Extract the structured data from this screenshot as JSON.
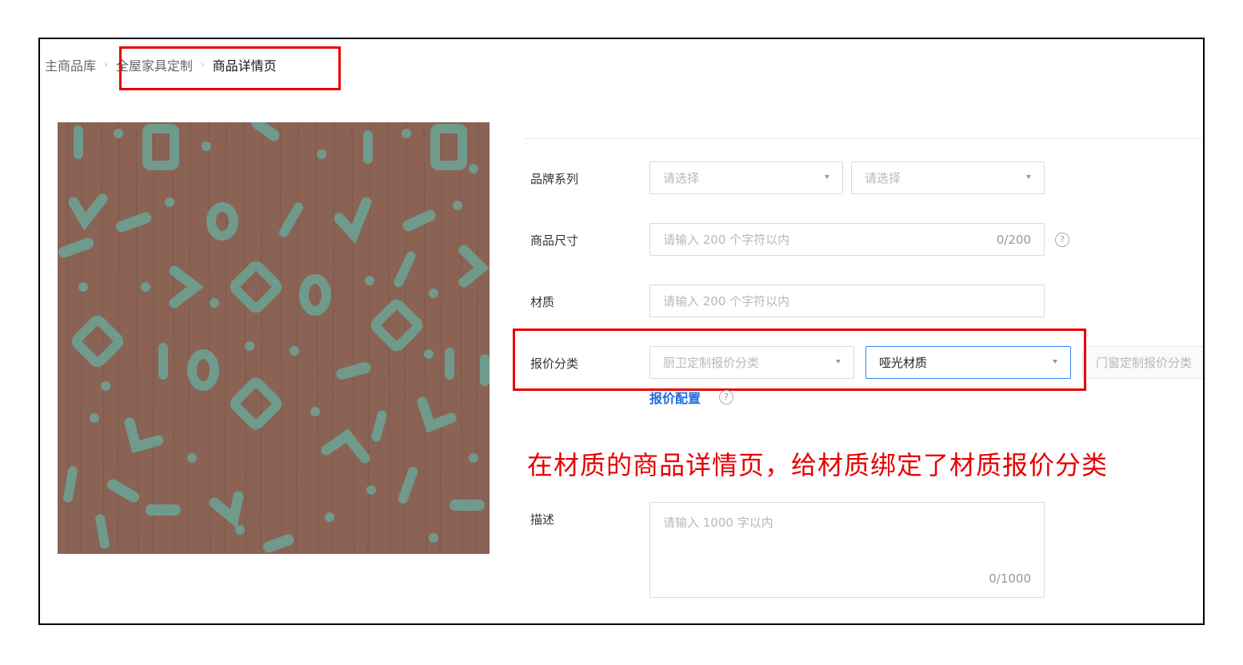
{
  "breadcrumb": {
    "items": [
      "主商品库",
      "全屋家具定制",
      "商品详情页"
    ],
    "separator": "›"
  },
  "product_image": {
    "description": "wood grain texture with teal confetti shapes",
    "base_color": "#8a6355",
    "pattern_color": "#6f9a8c"
  },
  "form": {
    "brand_series": {
      "label": "品牌系列",
      "select1_placeholder": "请选择",
      "select2_placeholder": "请选择"
    },
    "size": {
      "label": "商品尺寸",
      "placeholder": "请输入 200 个字符以内",
      "counter": "0/200"
    },
    "material": {
      "label": "材质",
      "placeholder": "请输入 200 个字符以内"
    },
    "quote_category": {
      "label": "报价分类",
      "select1_placeholder": "厨卫定制报价分类",
      "select2_value": "哑光材质",
      "select3_placeholder": "门窗定制报价分类"
    },
    "quote_config_link": "报价配置",
    "description": {
      "label": "描述",
      "placeholder": "请输入 1000 字以内",
      "counter": "0/1000"
    }
  },
  "annotation": {
    "text": "在材质的商品详情页，给材质绑定了材质报价分类",
    "color": "#e60000"
  },
  "icons": {
    "help": "?",
    "caret": "caret-down-icon"
  },
  "colors": {
    "highlight": "#e60000",
    "link": "#1e6de0",
    "active_border": "#3a7ff0"
  }
}
